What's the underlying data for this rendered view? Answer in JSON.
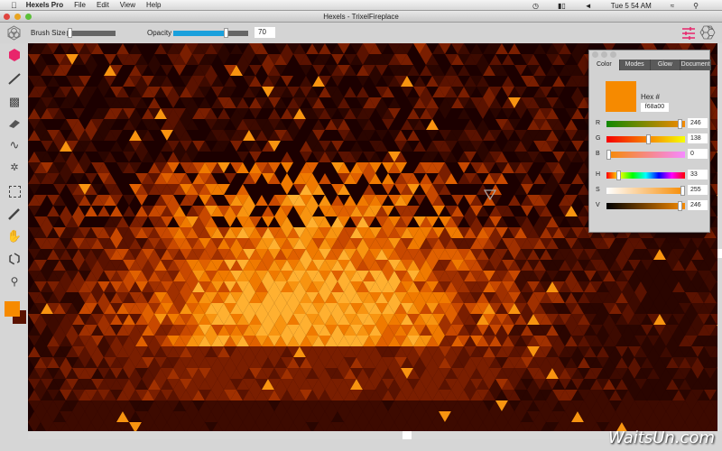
{
  "menubar": {
    "app": "Hexels Pro",
    "menus": [
      "File",
      "Edit",
      "View",
      "Help"
    ],
    "clock": "Tue 5 54 AM"
  },
  "window": {
    "title": "Hexels - TrixelFireplace"
  },
  "toolbar": {
    "brush_size_label": "Brush Size",
    "brush_size_fraction": 0.03,
    "opacity_label": "Opacity",
    "opacity_value": "70",
    "opacity_fraction": 0.7
  },
  "tools": [
    "hexagon-fill",
    "line",
    "paint-bucket",
    "eraser",
    "lasso-brush",
    "magic-wand",
    "marquee-select",
    "eyedropper",
    "hand",
    "lasso-outline",
    "zoom"
  ],
  "colors": {
    "primary": "#f68a00",
    "secondary": "#5a1200",
    "accent": "#e8256b",
    "canvas_bg": "#1c0000"
  },
  "panel": {
    "tabs": [
      "Color",
      "Modes",
      "Glow",
      "Document"
    ],
    "active_tab": "Color",
    "hex_label": "Hex #",
    "hex_value": "f68a00",
    "channels": [
      {
        "label": "R",
        "value": "246",
        "max": 255
      },
      {
        "label": "G",
        "value": "138",
        "max": 255
      },
      {
        "label": "B",
        "value": "0",
        "max": 255
      },
      {
        "label": "H",
        "value": "33",
        "max": 255
      },
      {
        "label": "S",
        "value": "255",
        "max": 255
      },
      {
        "label": "V",
        "value": "246",
        "max": 255
      }
    ]
  },
  "watermark": "WaitsUn.com"
}
